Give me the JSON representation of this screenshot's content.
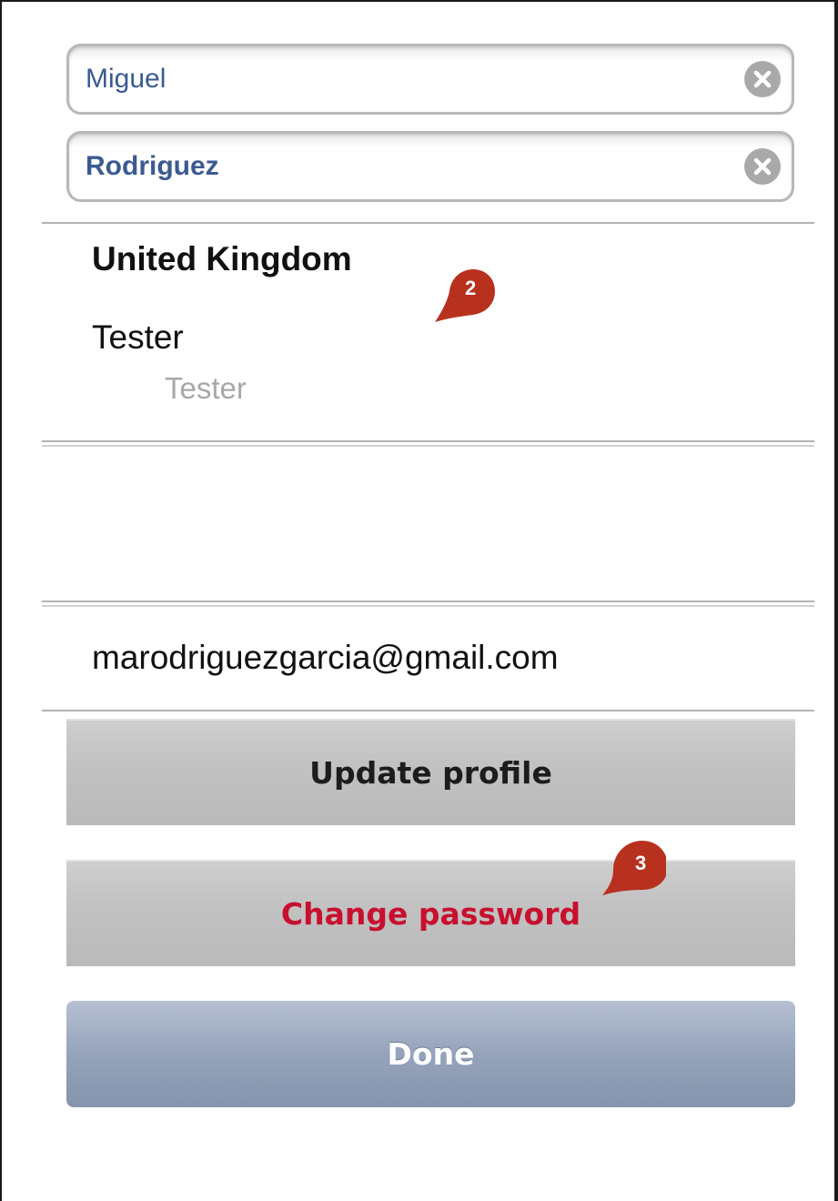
{
  "profile": {
    "first_name": "Miguel",
    "last_name": "Rodriguez",
    "country": "United Kingdom",
    "role": "Tester",
    "role_detail": "Tester",
    "email": "marodriguezgarcia@gmail.com"
  },
  "buttons": {
    "update_profile": "Update profile",
    "change_password": "Change password",
    "done": "Done"
  },
  "markers": {
    "m2": "2",
    "m3": "3"
  },
  "colors": {
    "input_text": "#3b5a92",
    "change_password_text": "#c8102e",
    "done_button": "#95a3bb",
    "marker": "#b8311f"
  },
  "icons": {
    "clear": "clear-circle-x-icon"
  }
}
